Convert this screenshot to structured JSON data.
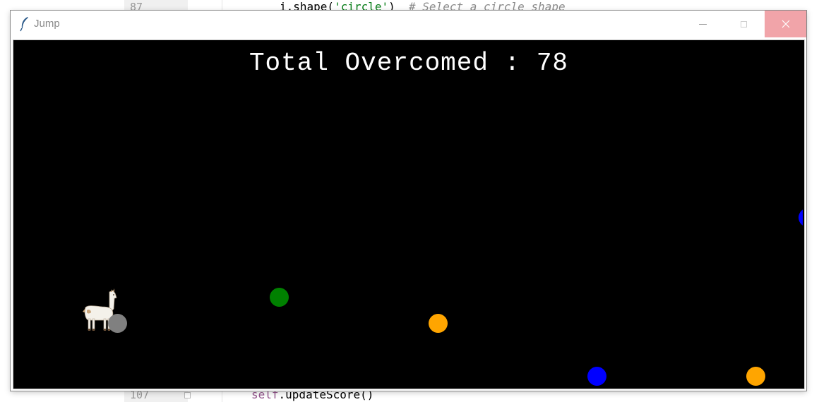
{
  "ide": {
    "top_line_number": "87",
    "top_line_code_pre": "i.shape(",
    "top_line_code_str": "'circle'",
    "top_line_code_post": ")  ",
    "top_line_comment": "# Select a circle shape",
    "bottom_line_number": "107",
    "bottom_line_self": "self",
    "bottom_line_code": ".updateScore()"
  },
  "window": {
    "title": "Jump",
    "icon": "feather-icon",
    "controls": {
      "minimize_icon": "minimize-icon",
      "maximize_icon": "maximize-icon",
      "close_icon": "close-icon",
      "close_bg": "#f1a4a9"
    }
  },
  "game": {
    "background": "#000000",
    "score_label": "Total Overcomed",
    "score_separator": ":",
    "score_value": "78",
    "score_text": "Total Overcomed : 78",
    "player": "llama-sprite",
    "balls": [
      {
        "color": "#808080",
        "name": "gray-ball"
      },
      {
        "color": "#008000",
        "name": "green-ball"
      },
      {
        "color": "#ffa500",
        "name": "orange-ball"
      },
      {
        "color": "#0000ff",
        "name": "blue-ball"
      },
      {
        "color": "#ffa500",
        "name": "orange-ball"
      },
      {
        "color": "#0000ff",
        "name": "blue-ball-edge"
      }
    ]
  }
}
